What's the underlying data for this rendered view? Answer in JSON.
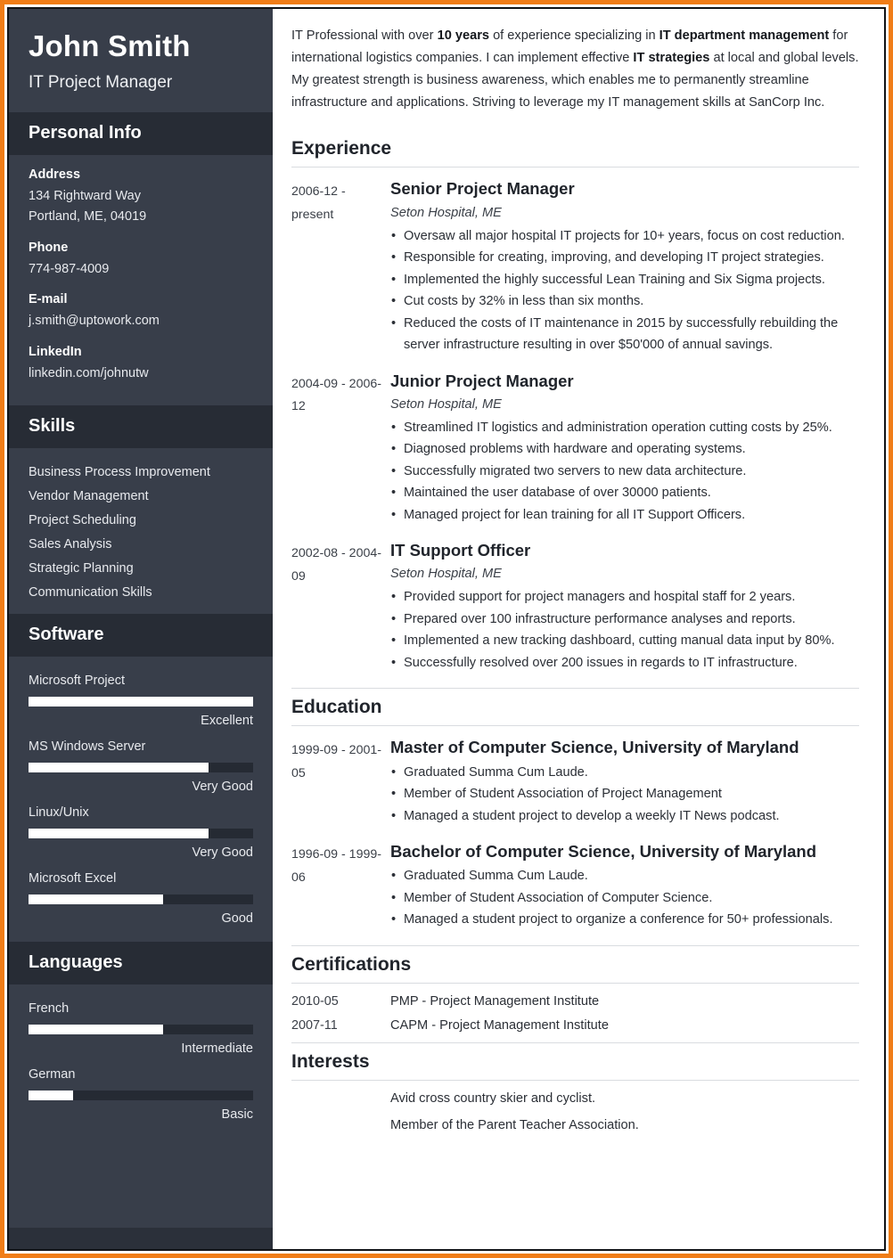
{
  "theme": {
    "frame_color": "#f07d18",
    "sidebar_bg": "#383e4a",
    "sidebar_header_bg": "#272c35",
    "bar_fill": "#ffffff",
    "bar_track": "#252a33",
    "text_dark": "#20242b"
  },
  "sidebar": {
    "name": "John Smith",
    "job_title": "IT Project Manager",
    "personal_info": {
      "heading": "Personal Info",
      "fields": [
        {
          "label": "Address",
          "value": "134 Rightward Way\nPortland, ME, 04019"
        },
        {
          "label": "Phone",
          "value": "774-987-4009"
        },
        {
          "label": "E-mail",
          "value": "j.smith@uptowork.com"
        },
        {
          "label": "LinkedIn",
          "value": "linkedin.com/johnutw"
        }
      ]
    },
    "skills": {
      "heading": "Skills",
      "items": [
        "Business Process Improvement",
        "Vendor Management",
        "Project Scheduling",
        "Sales Analysis",
        "Strategic Planning",
        "Communication Skills"
      ]
    },
    "software": {
      "heading": "Software",
      "items": [
        {
          "name": "Microsoft Project",
          "level": "Excellent",
          "percent": 100
        },
        {
          "name": "MS Windows Server",
          "level": "Very Good",
          "percent": 80
        },
        {
          "name": "Linux/Unix",
          "level": "Very Good",
          "percent": 80
        },
        {
          "name": "Microsoft Excel",
          "level": "Good",
          "percent": 60
        }
      ]
    },
    "languages": {
      "heading": "Languages",
      "items": [
        {
          "name": "French",
          "level": "Intermediate",
          "percent": 60
        },
        {
          "name": "German",
          "level": "Basic",
          "percent": 20
        }
      ]
    }
  },
  "main": {
    "summary": {
      "parts": [
        {
          "text": "IT Professional with over ",
          "bold": false
        },
        {
          "text": "10 years",
          "bold": true
        },
        {
          "text": " of experience specializing in ",
          "bold": false
        },
        {
          "text": "IT department management",
          "bold": true
        },
        {
          "text": " for international logistics companies. I can implement effective ",
          "bold": false
        },
        {
          "text": "IT strategies",
          "bold": true
        },
        {
          "text": " at local and global levels. My greatest strength is business awareness, which enables me to permanently streamline infrastructure and applications. Striving to leverage my IT management skills at SanCorp Inc.",
          "bold": false
        }
      ]
    },
    "experience": {
      "heading": "Experience",
      "entries": [
        {
          "dates": "2006-12 - present",
          "title": "Senior Project Manager",
          "employer": "Seton Hospital, ME",
          "bullets": [
            "Oversaw all major hospital IT projects for 10+ years, focus on cost reduction.",
            "Responsible for creating, improving, and developing IT project strategies.",
            "Implemented the highly successful Lean Training and Six Sigma projects.",
            "Cut costs by 32% in less than six months.",
            "Reduced the costs of IT maintenance in 2015 by successfully rebuilding the server infrastructure resulting in over $50'000 of annual savings."
          ]
        },
        {
          "dates": "2004-09 - 2006-12",
          "title": "Junior Project Manager",
          "employer": "Seton Hospital, ME",
          "bullets": [
            "Streamlined IT logistics and administration operation cutting costs by 25%.",
            "Diagnosed problems with hardware and operating systems.",
            "Successfully migrated two servers to new data architecture.",
            "Maintained the user database of over 30000 patients.",
            "Managed project for lean training for all IT Support Officers."
          ]
        },
        {
          "dates": "2002-08 - 2004-09",
          "title": "IT Support Officer",
          "employer": "Seton Hospital, ME",
          "bullets": [
            "Provided support for project managers and hospital staff for 2 years.",
            "Prepared over 100 infrastructure performance analyses and reports.",
            "Implemented a new tracking dashboard, cutting manual data input by 80%.",
            "Successfully resolved over 200 issues in regards to IT infrastructure."
          ]
        }
      ]
    },
    "education": {
      "heading": "Education",
      "entries": [
        {
          "dates": "1999-09 - 2001-05",
          "title": "Master of Computer Science, University of Maryland",
          "bullets": [
            "Graduated Summa Cum Laude.",
            "Member of Student Association of Project Management",
            "Managed a student project to develop a weekly IT News podcast."
          ]
        },
        {
          "dates": "1996-09 - 1999-06",
          "title": "Bachelor of Computer Science, University of Maryland",
          "bullets": [
            "Graduated Summa Cum Laude.",
            "Member of Student Association of Computer Science.",
            "Managed a student project to organize a conference for 50+ professionals."
          ]
        }
      ]
    },
    "certifications": {
      "heading": "Certifications",
      "rows": [
        {
          "date": "2010-05",
          "text": "PMP - Project Management Institute"
        },
        {
          "date": "2007-11",
          "text": "CAPM - Project Management Institute"
        }
      ]
    },
    "interests": {
      "heading": "Interests",
      "items": [
        "Avid cross country skier and cyclist.",
        "Member of the Parent Teacher Association."
      ]
    }
  }
}
